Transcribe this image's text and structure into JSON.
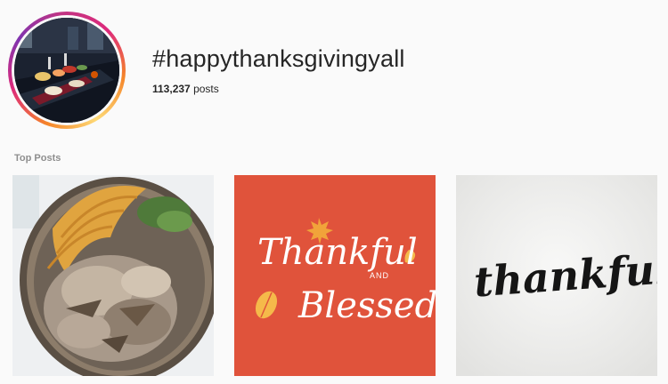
{
  "header": {
    "hashtag": "#happythanksgivingyall",
    "post_count_value": "113,237",
    "post_count_suffix": "posts"
  },
  "top_posts": {
    "label": "Top Posts",
    "posts": [
      {
        "kind": "photo",
        "subject": "roast-turkey-platter"
      },
      {
        "kind": "graphic",
        "line1": "Thankful",
        "joiner": "AND",
        "line2": "Blessed",
        "background": "#e0533b"
      },
      {
        "kind": "graphic",
        "line1": "thankful.",
        "background": "#f0f0ee"
      }
    ]
  },
  "colors": {
    "ring_start": "#f58529",
    "ring_mid": "#dd2a7b",
    "ring_end": "#8134af",
    "orange_tile": "#e0533b"
  }
}
